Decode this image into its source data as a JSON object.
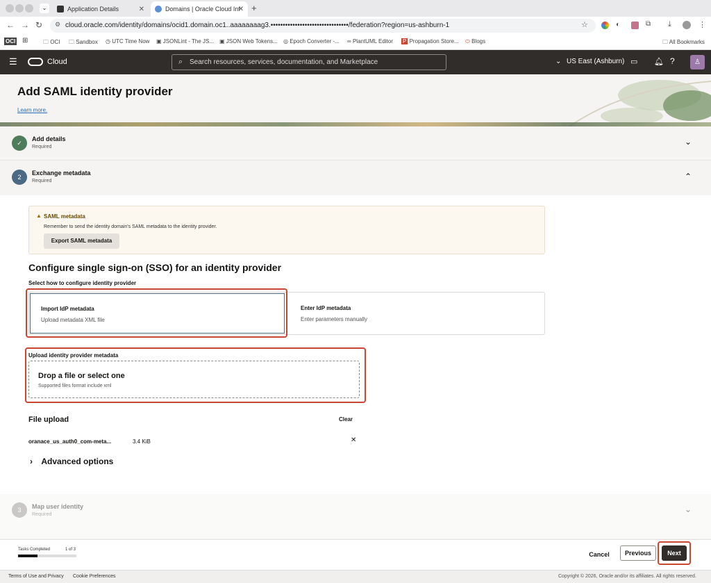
{
  "browser": {
    "tabs": [
      {
        "label": "Application Details"
      },
      {
        "label": "Domains | Oracle Cloud Infras"
      }
    ],
    "url": "cloud.oracle.com/identity/domains/ocid1.domain.oc1..aaaaaaaag3.••••••••••••••••••••••••••••••••/federation?region=us-ashburn-1",
    "bookmarks": [
      "OCI",
      "OCI",
      "Sandbox",
      "UTC Time Now",
      "JSONLint - The JS...",
      "JSON Web Tokens...",
      "Epoch Converter -...",
      "PlantUML Editor",
      "Propagation Store...",
      "Blogs",
      "All Bookmarks"
    ]
  },
  "header": {
    "brand": "Cloud",
    "search_placeholder": "Search resources, services, documentation, and Marketplace",
    "region": "US East (Ashburn)"
  },
  "page": {
    "title": "Add SAML identity provider",
    "learn_more": "Learn more."
  },
  "steps": [
    {
      "number": "✓",
      "title": "Add details",
      "sub": "Required"
    },
    {
      "number": "2",
      "title": "Exchange metadata",
      "sub": "Required"
    },
    {
      "number": "3",
      "title": "Map user identity",
      "sub": "Required"
    }
  ],
  "saml_notice": {
    "title": "SAML metadata",
    "text": "Remember to send the identity domain's SAML metadata to the identity provider.",
    "button": "Export SAML metadata"
  },
  "sso": {
    "heading": "Configure single sign-on (SSO) for an identity provider",
    "select_label": "Select how to configure identity provider",
    "options": [
      {
        "title": "Import IdP metadata",
        "desc": "Upload metadata XML file"
      },
      {
        "title": "Enter IdP metadata",
        "desc": "Enter parameters manually"
      }
    ],
    "upload_label": "Upload identity provider metadata",
    "drop_title": "Drop a file or select one",
    "drop_sub": "Supported files format include xml"
  },
  "file_upload": {
    "title": "File upload",
    "clear": "Clear",
    "file_name": "oranace_us_auth0_com-meta...",
    "file_size": "3.4 KiB"
  },
  "advanced": "Advanced options",
  "footer": {
    "tasks_label": "Tasks Completed",
    "tasks_count": "1 of 3",
    "progress": 0.33,
    "cancel": "Cancel",
    "previous": "Previous",
    "next": "Next"
  },
  "bottom": {
    "terms": "Terms of Use and Privacy",
    "cookies": "Cookie Preferences",
    "copyright": "Copyright © 2026, Oracle and/or its affiliates. All rights reserved."
  },
  "colors": {
    "accent_red": "#c74634",
    "header_dark": "#312d2a",
    "step_done": "#4f7d5c",
    "step_active": "#4b6b84"
  }
}
